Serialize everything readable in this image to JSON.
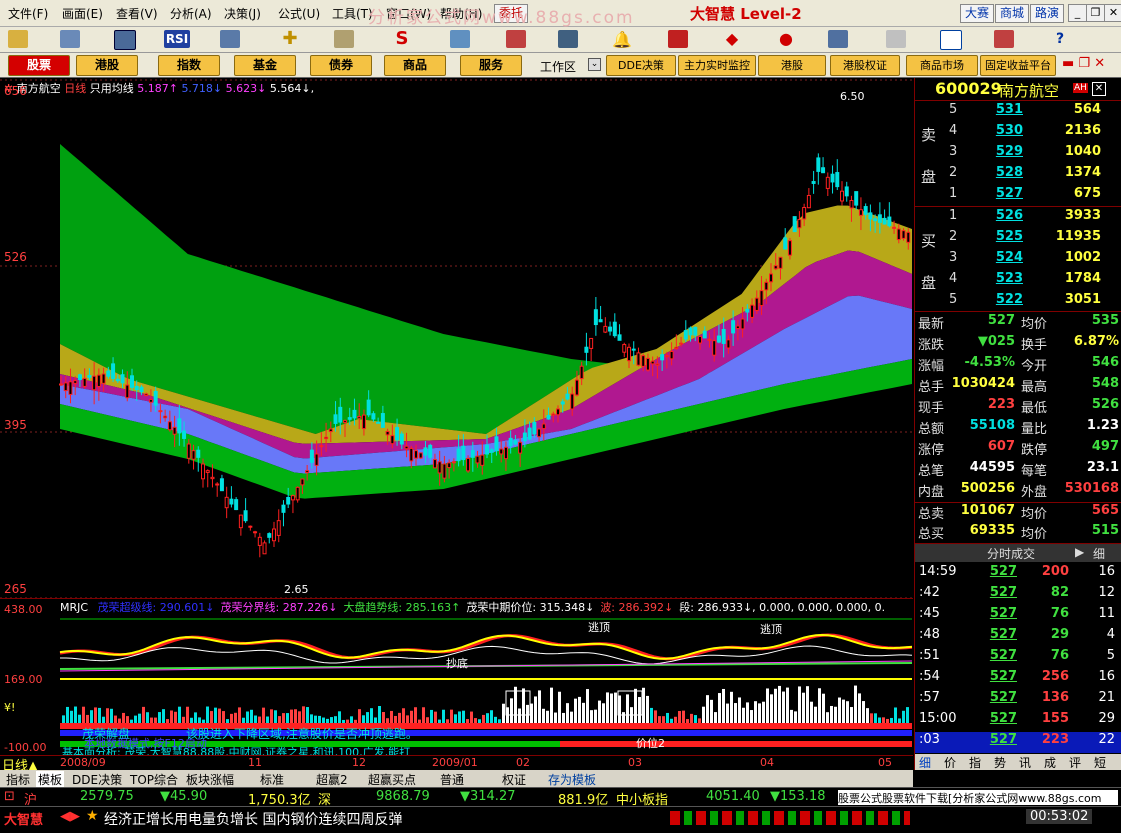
{
  "menubar": {
    "items": [
      "文件(F)",
      "画面(E)",
      "查看(V)",
      "分析(A)",
      "决策(J)",
      "公式(U)",
      "工具(T)",
      "窗口(W)",
      "帮助(H)"
    ],
    "trade_label": "委托",
    "watermark": "分析家公式网www.88gs.com",
    "brand": "大智慧 Level-2",
    "right_buttons": [
      "大赛",
      "商城",
      "路演"
    ]
  },
  "toolbar": {
    "tool_icons": [
      "open-icon",
      "kline-icon",
      "screen-icon",
      "rsi-icon",
      "calc-icon",
      "cross-icon",
      "ruler-icon",
      "s-icon",
      "cross-line-icon",
      "bars-icon",
      "binocular-icon",
      "bell-icon",
      "flag-icon",
      "diamond-icon",
      "circle-icon",
      "doc-icon",
      "window-icon",
      "book-icon",
      "help-icon"
    ],
    "rsi_label": "RSI"
  },
  "nav": {
    "buttons": [
      "股票",
      "港股",
      "指数",
      "基金",
      "债券",
      "商品",
      "服务"
    ],
    "workspace": "工作区",
    "buttons2": [
      "DDE决策",
      "主力实时监控",
      "港股",
      "港股权证",
      "商品市场",
      "固定收益平台"
    ]
  },
  "chart": {
    "header": {
      "name": "南方航空",
      "period": "日线",
      "mode": "只用均线",
      "ma": [
        "5.187↑",
        "5.718↓",
        "5.623↓",
        "5.564↓,"
      ]
    },
    "y_ticks": [
      "656",
      "526",
      "395",
      "265"
    ],
    "high_label": "6.50",
    "low_label": "2.65",
    "x_ticks": [
      "2008/09",
      "11",
      "12",
      "2009/01",
      "02",
      "03",
      "04",
      "05"
    ]
  },
  "chart_data": {
    "type": "candlestick",
    "ylim": [
      265,
      656
    ],
    "y_ticks": [
      656,
      526,
      395,
      265
    ],
    "x_ticks": [
      "2008/09",
      "11",
      "12",
      "2009/01",
      "02",
      "03",
      "04",
      "05"
    ],
    "bands": {
      "green_top": [
        [
          0,
          0.9
        ],
        [
          0.15,
          0.68
        ],
        [
          0.45,
          0.52
        ],
        [
          0.6,
          0.47
        ],
        [
          0.75,
          0.44
        ],
        [
          0.9,
          0.44
        ],
        [
          1,
          0.4
        ]
      ],
      "yellow_top": [
        [
          0,
          0.5
        ],
        [
          0.08,
          0.43
        ],
        [
          0.3,
          0.32
        ],
        [
          0.35,
          0.35
        ],
        [
          0.5,
          0.32
        ],
        [
          0.62,
          0.45
        ],
        [
          0.7,
          0.49
        ],
        [
          0.8,
          0.6
        ],
        [
          0.87,
          0.76
        ],
        [
          0.92,
          0.78
        ],
        [
          1,
          0.73
        ]
      ],
      "magenta_top": [
        [
          0,
          0.44
        ],
        [
          0.1,
          0.4
        ],
        [
          0.28,
          0.3
        ],
        [
          0.5,
          0.31
        ],
        [
          0.6,
          0.37
        ],
        [
          0.72,
          0.49
        ],
        [
          0.82,
          0.58
        ],
        [
          0.88,
          0.66
        ],
        [
          0.93,
          0.69
        ],
        [
          1,
          0.64
        ]
      ],
      "blue_top": [
        [
          0,
          0.42
        ],
        [
          0.15,
          0.37
        ],
        [
          0.28,
          0.27
        ],
        [
          0.5,
          0.3
        ],
        [
          0.6,
          0.33
        ],
        [
          0.75,
          0.43
        ],
        [
          0.85,
          0.53
        ],
        [
          0.93,
          0.6
        ],
        [
          1,
          0.57
        ]
      ],
      "green_bottom": [
        [
          0,
          0.38
        ],
        [
          0.15,
          0.32
        ],
        [
          0.28,
          0.24
        ],
        [
          0.45,
          0.26
        ],
        [
          0.55,
          0.3
        ],
        [
          0.7,
          0.36
        ],
        [
          0.85,
          0.42
        ],
        [
          1,
          0.47
        ]
      ]
    }
  },
  "indicator1": {
    "name": "MRJC",
    "items": [
      {
        "label": "茂荣超级线:",
        "value": "290.601↓",
        "color": "#3030ff"
      },
      {
        "label": "茂荣分界线:",
        "value": "287.226↓",
        "color": "#ff40ff"
      },
      {
        "label": "大盘趋势线:",
        "value": "285.163↑",
        "color": "#40e040"
      },
      {
        "label": "茂荣中期价位:",
        "value": "315.348↓",
        "color": "#ffffff"
      },
      {
        "label": "波:",
        "value": "286.392↓",
        "color": "#ff4040"
      },
      {
        "label": "段:",
        "value": "286.933↓, 0.000, 0.000, 0.000, 0.",
        "color": "#ffffff"
      }
    ],
    "y_ticks": [
      "438.00",
      "169.00"
    ],
    "labels": [
      "逃顶",
      "逃顶",
      "抄底"
    ]
  },
  "indicator2": {
    "y_ticks": [
      "-100.00"
    ],
    "text_a": "茂荣解盘",
    "text_b": "该股进入下降区域,注意股价是否冲顶逃跑。",
    "text_c": "本地数据模式,按F12启动",
    "text_d": "价位2",
    "text_e": "基本面分析: 茂荣,大智慧88,88股,中财网,证券之星,和讯,100,广发,能打",
    "side": "¥!"
  },
  "quote": {
    "code": "600029",
    "name": "南方航空",
    "badge": "AH",
    "sell_label": [
      "卖",
      "盘"
    ],
    "buy_label": [
      "买",
      "盘"
    ],
    "sell": [
      {
        "idx": "5",
        "price": "531",
        "vol": "564"
      },
      {
        "idx": "4",
        "price": "530",
        "vol": "2136"
      },
      {
        "idx": "3",
        "price": "529",
        "vol": "1040"
      },
      {
        "idx": "2",
        "price": "528",
        "vol": "1374"
      },
      {
        "idx": "1",
        "price": "527",
        "vol": "675"
      }
    ],
    "buy": [
      {
        "idx": "1",
        "price": "526",
        "vol": "3933"
      },
      {
        "idx": "2",
        "price": "525",
        "vol": "11935"
      },
      {
        "idx": "3",
        "price": "524",
        "vol": "1002"
      },
      {
        "idx": "4",
        "price": "523",
        "vol": "1784"
      },
      {
        "idx": "5",
        "price": "522",
        "vol": "3051"
      }
    ],
    "stats": [
      {
        "l1": "最新",
        "v1": "527",
        "c1": "green",
        "l2": "均价",
        "v2": "535",
        "c2": "green"
      },
      {
        "l1": "涨跌",
        "v1": "▼025",
        "c1": "green",
        "l2": "换手",
        "v2": "6.87%",
        "c2": "yellow"
      },
      {
        "l1": "涨幅",
        "v1": "-4.53%",
        "c1": "green",
        "l2": "今开",
        "v2": "546",
        "c2": "green"
      },
      {
        "l1": "总手",
        "v1": "1030424",
        "c1": "yellow",
        "l2": "最高",
        "v2": "548",
        "c2": "green"
      },
      {
        "l1": "现手",
        "v1": "223",
        "c1": "red",
        "l2": "最低",
        "v2": "526",
        "c2": "green"
      },
      {
        "l1": "总额",
        "v1": "55108",
        "c1": "cyan",
        "l2": "量比",
        "v2": "1.23",
        "c2": "white"
      },
      {
        "l1": "涨停",
        "v1": "607",
        "c1": "red",
        "l2": "跌停",
        "v2": "497",
        "c2": "green"
      },
      {
        "l1": "总笔",
        "v1": "44595",
        "c1": "white",
        "l2": "每笔",
        "v2": "23.1",
        "c2": "white"
      },
      {
        "l1": "内盘",
        "v1": "500256",
        "c1": "yellow",
        "l2": "外盘",
        "v2": "530168",
        "c2": "red"
      },
      {
        "l1": "总卖",
        "v1": "101067",
        "c1": "yellow",
        "l2": "均价",
        "v2": "565",
        "c2": "red"
      },
      {
        "l1": "总买",
        "v1": "69335",
        "c1": "yellow",
        "l2": "均价",
        "v2": "515",
        "c2": "green"
      }
    ],
    "ticks_title": "分时成交",
    "ticks_btn": "细",
    "ticks": [
      {
        "t": "14:59",
        "p": "527",
        "v": "200",
        "n": "16"
      },
      {
        "t": ":42",
        "p": "527",
        "v": "82",
        "n": "12"
      },
      {
        "t": ":45",
        "p": "527",
        "v": "76",
        "n": "11"
      },
      {
        "t": ":48",
        "p": "527",
        "v": "29",
        "n": "4"
      },
      {
        "t": ":51",
        "p": "527",
        "v": "76",
        "n": "5"
      },
      {
        "t": ":54",
        "p": "527",
        "v": "256",
        "n": "16"
      },
      {
        "t": ":57",
        "p": "527",
        "v": "136",
        "n": "21"
      },
      {
        "t": "15:00",
        "p": "527",
        "v": "155",
        "n": "29"
      },
      {
        "t": ":03",
        "p": "527",
        "v": "223",
        "n": "22"
      }
    ],
    "bottom_tabs": [
      "细",
      "价",
      "指",
      "势",
      "讯",
      "成",
      "评",
      "短"
    ]
  },
  "bottom": {
    "period": "日线▲",
    "tabs": [
      "指标",
      "模板",
      "DDE决策",
      "TOP综合",
      "板块涨幅",
      "标准",
      "超赢2",
      "超赢买点",
      "普通",
      "权证",
      "存为模板"
    ],
    "index": {
      "sh": "沪",
      "sh_val": "2579.75",
      "sh_chg": "▼45.90",
      "sh_amt": "1,750.3亿",
      "sz": "深",
      "sz_val": "9868.79",
      "sz_chg": "▼314.27",
      "sz_amt": "881.9亿",
      "zx": "中小板指",
      "zx_val": "4051.40",
      "zx_chg": "▼153.18",
      "ad": "股票公式股票软件下载[分析家公式网www.88gs.com"
    },
    "ticker": {
      "logo": "大智慧",
      "news": "经济正增长用电量负增长 国内钢价连续四周反弹",
      "time": "00:53:02"
    }
  }
}
